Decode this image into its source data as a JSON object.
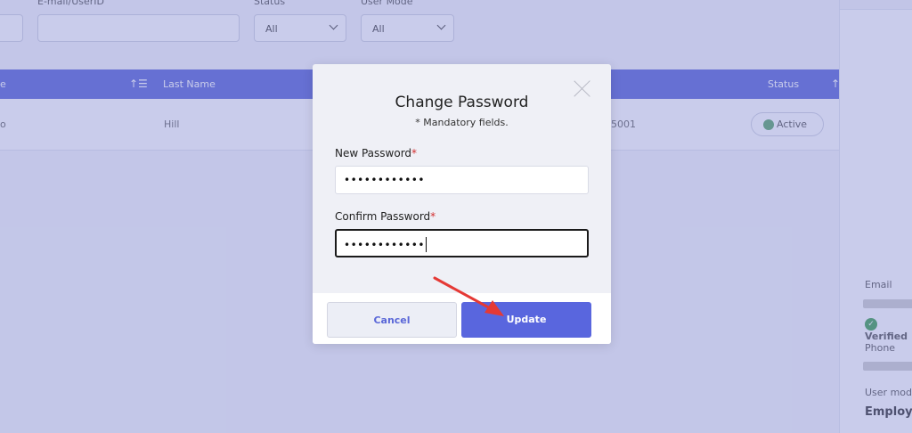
{
  "filters": {
    "email_label": "E-mail/UserID",
    "status_label": "Status",
    "status_value": "All",
    "usermode_label": "User Mode",
    "usermode_value": "All"
  },
  "table": {
    "headers": {
      "col_first_partial": "e",
      "last_name": "Last Name",
      "status": "Status"
    },
    "row": {
      "first_partial": "o",
      "last_name": "Hill",
      "id_partial": "5001",
      "status": "Active"
    }
  },
  "right_panel": {
    "email_label": "Email",
    "verified_text": "Verified",
    "phone_label": "Phone",
    "usermode_label": "User mod",
    "usermode_value": "Employe"
  },
  "modal": {
    "title": "Change Password",
    "subtitle": "* Mandatory fields.",
    "new_password_label": "New Password",
    "new_password_value": "••••••••••••",
    "confirm_password_label": "Confirm Password",
    "confirm_password_value": "••••••••••••",
    "required_mark": "*",
    "cancel_label": "Cancel",
    "update_label": "Update"
  },
  "colors": {
    "accent": "#5966de",
    "required": "#d32f2f",
    "annotation_arrow": "#e53935"
  },
  "icons": [
    "chevron-down-icon",
    "sort-icon",
    "close-icon",
    "check-circle-icon",
    "arrow-annotation-icon"
  ]
}
